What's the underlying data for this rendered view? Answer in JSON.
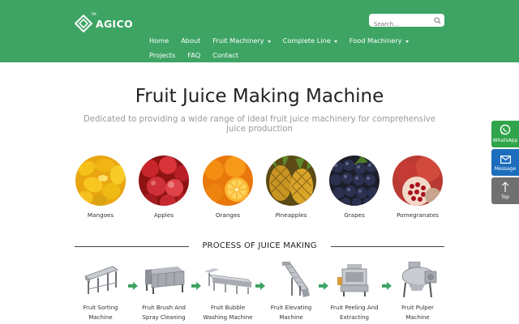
{
  "brand": {
    "name": "AGICO",
    "tm": "TM"
  },
  "search": {
    "placeholder": "Search..."
  },
  "nav": {
    "row1": [
      {
        "label": "Home",
        "dropdown": false
      },
      {
        "label": "About",
        "dropdown": false
      },
      {
        "label": "Fruit Machinery",
        "dropdown": true
      },
      {
        "label": "Complete Line",
        "dropdown": true
      },
      {
        "label": "Food Machinery",
        "dropdown": true
      }
    ],
    "row2": [
      {
        "label": "Projects",
        "dropdown": false
      },
      {
        "label": "FAQ",
        "dropdown": false
      },
      {
        "label": "Contact",
        "dropdown": false
      }
    ]
  },
  "hero": {
    "title": "Fruit Juice Making Machine",
    "subtitle": "Dedicated to providing a wide range of ideal fruit juice machinery for comprehensive juice production"
  },
  "fruits": [
    {
      "label": "Mangoes"
    },
    {
      "label": "Apples"
    },
    {
      "label": "Oranges"
    },
    {
      "label": "Pineapples"
    },
    {
      "label": "Grapes"
    },
    {
      "label": "Pomegranates"
    }
  ],
  "process": {
    "title": "PROCESS OF JUICE MAKING",
    "machines": [
      {
        "line1": "Fruit Sorting",
        "line2": "Machine"
      },
      {
        "line1": "Fruit Brush And",
        "line2": "Spray Cleaning"
      },
      {
        "line1": "Fruit Bubble",
        "line2": "Washing Machine"
      },
      {
        "line1": "Fruit Elevating",
        "line2": "Machine"
      },
      {
        "line1": "Fruit Peeling And",
        "line2": "Extracting"
      },
      {
        "line1": "Fruit Pulper",
        "line2": "Machine"
      }
    ]
  },
  "side": {
    "whatsapp": "WhatsApp",
    "message": "Message",
    "top": "Top"
  },
  "colors": {
    "header_green": "#3ea464",
    "whatsapp_green": "#2fa44a",
    "message_blue": "#1c6dbd",
    "top_gray": "#707070",
    "arrow_green": "#3ea464"
  }
}
